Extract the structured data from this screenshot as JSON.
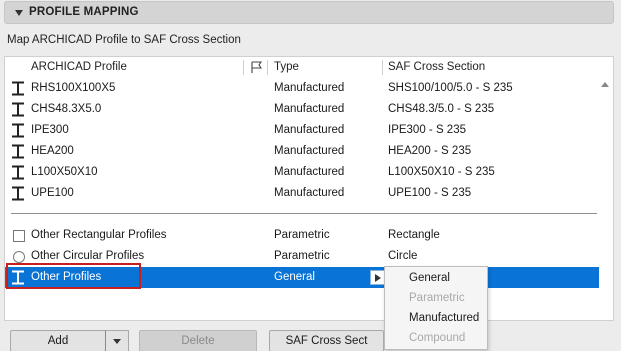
{
  "section": {
    "title": "PROFILE MAPPING"
  },
  "caption": "Map ARCHICAD Profile to SAF Cross Section",
  "columns": {
    "profile": "ARCHICAD Profile",
    "type": "Type",
    "saf": "SAF Cross Section"
  },
  "rows": [
    {
      "name": "RHS100X100X5",
      "type": "Manufactured",
      "saf": "SHS100/100/5.0 - S 235",
      "icon": "i-beam-icon"
    },
    {
      "name": "CHS48.3X5.0",
      "type": "Manufactured",
      "saf": "CHS48.3/5.0 - S 235",
      "icon": "i-beam-icon"
    },
    {
      "name": "IPE300",
      "type": "Manufactured",
      "saf": "IPE300 - S 235",
      "icon": "i-beam-icon"
    },
    {
      "name": "HEA200",
      "type": "Manufactured",
      "saf": "HEA200 - S 235",
      "icon": "i-beam-icon"
    },
    {
      "name": "L100X50X10",
      "type": "Manufactured",
      "saf": "L100X50X10 - S 235",
      "icon": "i-beam-icon"
    },
    {
      "name": "UPE100",
      "type": "Manufactured",
      "saf": "UPE100 - S 235",
      "icon": "i-beam-icon"
    }
  ],
  "other_rows": [
    {
      "name": "Other Rectangular Profiles",
      "type": "Parametric",
      "saf": "Rectangle",
      "icon": "checkbox-icon"
    },
    {
      "name": "Other Circular Profiles",
      "type": "Parametric",
      "saf": "Circle",
      "icon": "radio-icon"
    },
    {
      "name": "Other Profiles",
      "type": "General",
      "saf": "",
      "icon": "i-beam-icon",
      "selected": true
    }
  ],
  "dropdown": {
    "options": [
      {
        "label": "General",
        "enabled": true
      },
      {
        "label": "Parametric",
        "enabled": false
      },
      {
        "label": "Manufactured",
        "enabled": true
      },
      {
        "label": "Compound",
        "enabled": false
      }
    ]
  },
  "buttons": {
    "add": "Add",
    "delete": "Delete",
    "saf_cross_section": "SAF Cross Sect"
  },
  "colors": {
    "selection": "#0a73d6",
    "highlight": "#c81e1e"
  }
}
